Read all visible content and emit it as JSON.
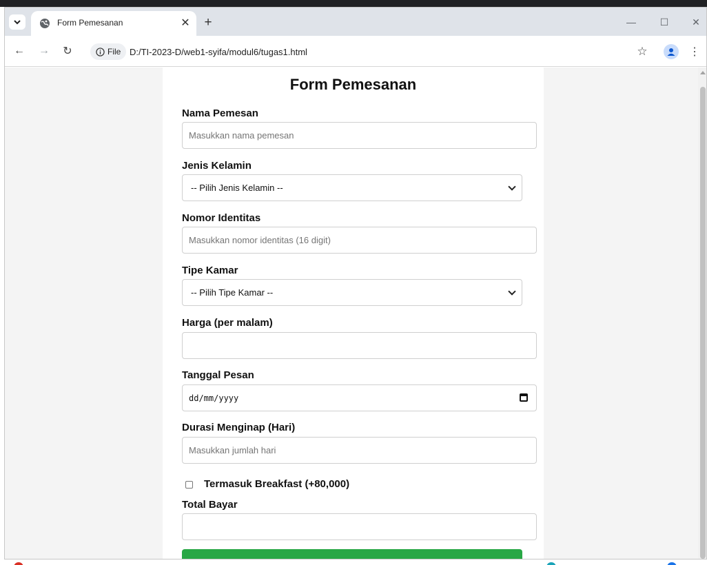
{
  "browser": {
    "tab_title": "Form Pemesanan",
    "new_tab_symbol": "+",
    "info_chip_label": "File",
    "url": "D:/TI-2023-D/web1-syifa/modul6/tugas1.html"
  },
  "form": {
    "title": "Form Pemesanan",
    "nama": {
      "label": "Nama Pemesan",
      "placeholder": "Masukkan nama pemesan"
    },
    "jenis_kelamin": {
      "label": "Jenis Kelamin",
      "selected": "-- Pilih Jenis Kelamin --"
    },
    "nomor": {
      "label": "Nomor Identitas",
      "placeholder": "Masukkan nomor identitas (16 digit)"
    },
    "tipe_kamar": {
      "label": "Tipe Kamar",
      "selected": "-- Pilih Tipe Kamar --"
    },
    "harga": {
      "label": "Harga (per malam)",
      "value": ""
    },
    "tanggal": {
      "label": "Tanggal Pesan",
      "placeholder": "dd/mm/yyyy"
    },
    "durasi": {
      "label": "Durasi Menginap (Hari)",
      "placeholder": "Masukkan jumlah hari"
    },
    "breakfast": {
      "label": "Termasuk Breakfast (+80,000)",
      "checked": false
    },
    "total": {
      "label": "Total Bayar",
      "value": ""
    }
  },
  "icons": {
    "tab_search": "chevron-down-icon",
    "favicon": "globe-icon",
    "tab_close": "close-icon",
    "back": "back-arrow-icon",
    "forward": "forward-arrow-icon",
    "reload": "reload-icon",
    "info": "info-icon",
    "bookmark": "star-icon",
    "profile": "profile-icon",
    "menu": "kebab-menu-icon",
    "minimize": "minimize-icon",
    "maximize": "maximize-icon",
    "close_window": "close-window-icon",
    "calendar": "calendar-icon",
    "select_arrow": "chevron-down-icon"
  },
  "colors": {
    "submit_green": "#28a745",
    "page_bg": "#f4f4f4",
    "tabbar_bg": "#dfe3e9"
  }
}
